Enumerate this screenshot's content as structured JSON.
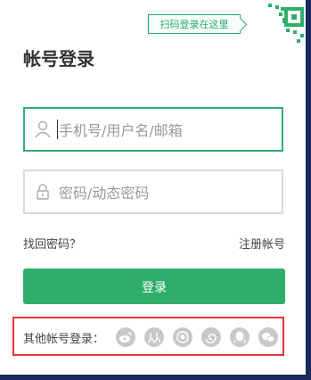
{
  "qr_prompt": "扫码登录在这里",
  "title": "帐号登录",
  "username": {
    "placeholder": "手机号/用户名/邮箱",
    "value": ""
  },
  "password": {
    "placeholder": "密码/动态密码",
    "value": ""
  },
  "links": {
    "forgot": "找回密码？",
    "register": "注册帐号"
  },
  "login_button": "登录",
  "social": {
    "label": "其他帐号登录：",
    "providers": [
      "weibo",
      "renren",
      "baidu",
      "other",
      "qq",
      "wechat"
    ]
  },
  "colors": {
    "accent": "#2fae6b",
    "highlight": "#e3393c",
    "frame": "#1c2a5b"
  }
}
